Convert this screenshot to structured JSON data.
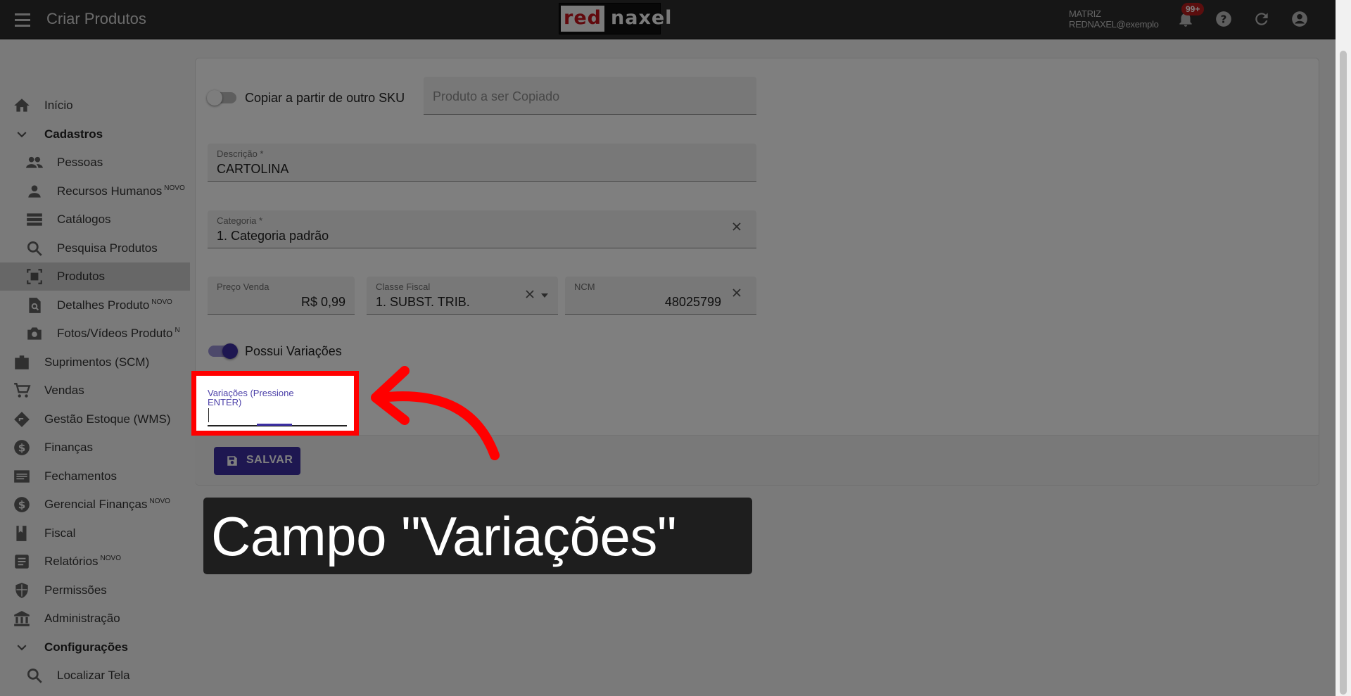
{
  "topbar": {
    "title": "Criar Produtos",
    "logo": {
      "red": "red",
      "rest": "naxel"
    },
    "user_line1": "MATRIZ",
    "user_line2": "REDNAXEL@exemplo",
    "notifications_badge": "99+"
  },
  "sidebar": {
    "items": [
      {
        "label": "Início",
        "icon": "home-icon"
      },
      {
        "label": "Cadastros",
        "icon": "chevron-down-icon"
      },
      {
        "label": "Pessoas",
        "icon": "people-icon"
      },
      {
        "label": "Recursos Humanos",
        "tag": "NOVO",
        "icon": "person-icon"
      },
      {
        "label": "Catálogos",
        "icon": "list-icon"
      },
      {
        "label": "Pesquisa Produtos",
        "icon": "search-icon"
      },
      {
        "label": "Produtos",
        "icon": "product-scan-icon"
      },
      {
        "label": "Detalhes Produto",
        "tag": "NOVO",
        "icon": "doc-search-icon"
      },
      {
        "label": "Fotos/Vídeos Produto",
        "tag": "N",
        "icon": "camera-icon"
      },
      {
        "label": "Suprimentos (SCM)",
        "icon": "briefcase-icon"
      },
      {
        "label": "Vendas",
        "icon": "cart-icon"
      },
      {
        "label": "Gestão Estoque (WMS)",
        "icon": "diamond-icon"
      },
      {
        "label": "Finanças",
        "icon": "dollar-icon"
      },
      {
        "label": "Fechamentos",
        "icon": "receipt-icon"
      },
      {
        "label": "Gerencial Finanças",
        "tag": "NOVO",
        "icon": "dollar-icon"
      },
      {
        "label": "Fiscal",
        "icon": "book-icon"
      },
      {
        "label": "Relatórios",
        "tag": "NOVO",
        "icon": "report-icon"
      },
      {
        "label": "Permissões",
        "icon": "shield-icon"
      },
      {
        "label": "Administração",
        "icon": "bank-icon"
      },
      {
        "label": "Configurações",
        "icon": "chevron-down-icon"
      },
      {
        "label": "Localizar Tela",
        "icon": "search-icon"
      }
    ]
  },
  "form": {
    "copy_toggle_label": "Copiar a partir de outro SKU",
    "copy_placeholder": "Produto a ser Copiado",
    "descricao_label": "Descrição *",
    "descricao_value": "CARTOLINA",
    "categoria_label": "Categoria *",
    "categoria_value": "1. Categoria padrão",
    "preco_label": "Preço Venda",
    "preco_value": "R$ 0,99",
    "classe_label": "Classe Fiscal",
    "classe_value": "1. SUBST. TRIB.",
    "ncm_label": "NCM",
    "ncm_value": "48025799",
    "variacoes_toggle_label": "Possui Variações",
    "variacoes_field_label": "Variações (Pressione ENTER)",
    "variacoes_value": "",
    "save_label": "SALVAR"
  },
  "callout": {
    "text": "Campo \"Variações\""
  },
  "colors": {
    "accent": "#3c2fa3",
    "highlight": "#ff0000",
    "brand_red": "#c2131a"
  }
}
